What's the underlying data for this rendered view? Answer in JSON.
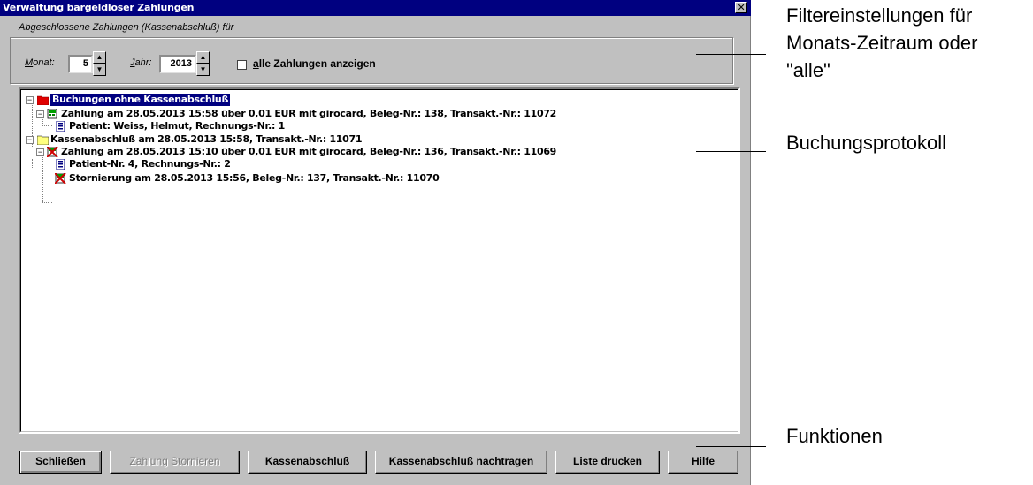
{
  "window": {
    "title": "Verwaltung bargeldloser Zahlungen",
    "close_glyph": "✕"
  },
  "filter": {
    "group_label": "Abgeschlossene Zahlungen (Kassenabschluß) für",
    "month_label_key": "M",
    "month_label_rest": "onat:",
    "month_value": "5",
    "year_label_key": "J",
    "year_label_rest": "ahr:",
    "year_value": "2013",
    "show_all_key": "a",
    "show_all_rest": "lle Zahlungen anzeigen",
    "show_all_checked": false
  },
  "tree": {
    "nodes": [
      {
        "text": "Buchungen ohne Kassenabschluß",
        "level": 0,
        "icon": "red-folder-icon",
        "selected": true,
        "expanded": true
      },
      {
        "text": "Zahlung am 28.05.2013 15:58 über 0,01 EUR mit girocard, Beleg-Nr.: 138, Transakt.-Nr.: 11072",
        "level": 1,
        "icon": "green-card-terminal-icon",
        "selected": false,
        "expanded": true
      },
      {
        "text": "Patient: Weiss, Helmut, Rechnungs-Nr.: 1",
        "level": 2,
        "icon": "patient-file-icon",
        "selected": false
      },
      {
        "text": "Kassenabschluß am 28.05.2013 15:58, Transakt.-Nr.: 11071",
        "level": 0,
        "icon": "yellow-folder-icon",
        "selected": false,
        "expanded": true
      },
      {
        "text": "Zahlung am 28.05.2013 15:10 über 0,01 EUR mit girocard, Beleg-Nr.: 136, Transakt.-Nr.: 11069",
        "level": 1,
        "icon": "cancelled-card-terminal-icon",
        "selected": false,
        "expanded": true
      },
      {
        "text": "Patient-Nr. 4, Rechnungs-Nr.: 2",
        "level": 2,
        "icon": "patient-file-icon",
        "selected": false
      },
      {
        "text": "Stornierung am 28.05.2013 15:56, Beleg-Nr.: 137, Transakt.-Nr.: 11070",
        "level": 2,
        "icon": "cancelled-card-terminal-icon",
        "selected": false
      }
    ],
    "expander_glyph": "−"
  },
  "buttons": {
    "close_key": "S",
    "close_rest": "chließen",
    "storno_label": "Zahlung Stornieren",
    "close_register_key": "K",
    "close_register_rest": "assenabschluß",
    "add_close_before": "Kassenabschluß ",
    "add_close_key": "n",
    "add_close_rest": "achtragen",
    "print_key": "L",
    "print_rest": "iste drucken",
    "help_key": "H",
    "help_rest": "ilfe"
  },
  "annotations": {
    "filter": "Filtereinstellungen für Monats-Zeitraum oder \"alle\"",
    "filter_line1": "Filtereinstellungen für",
    "filter_line2": "Monats-Zeitraum oder",
    "filter_line3": "\"alle\"",
    "protocol": "Buchungsprotokoll",
    "functions": "Funktionen"
  },
  "colors": {
    "titlebar": "#000080",
    "dialog_bg": "#c0c0c0",
    "selection": "#000080",
    "red_folder": "#e00000",
    "yellow_folder": "#ffff80",
    "green_icon": "#008000",
    "cancel_red": "#d00000"
  }
}
